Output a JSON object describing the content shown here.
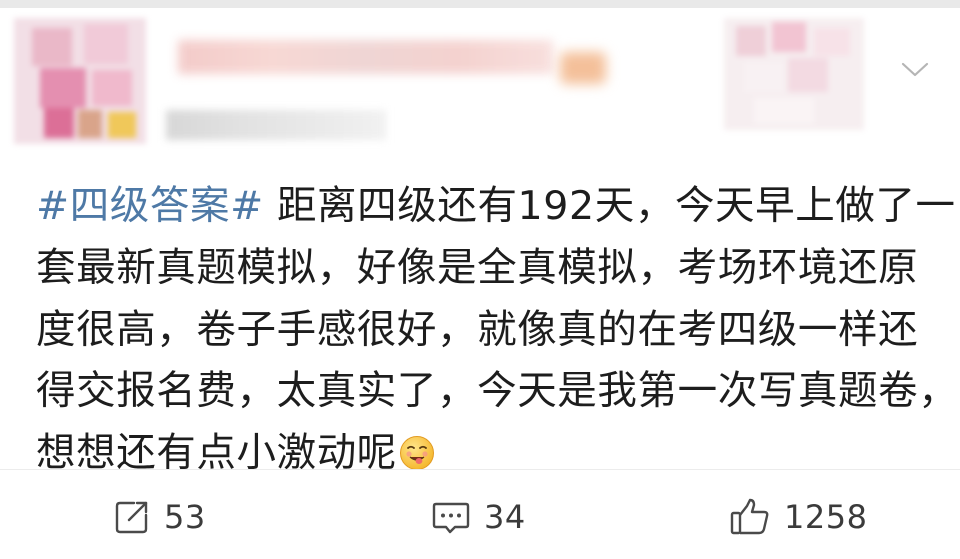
{
  "post": {
    "hashtag": "#四级答案#",
    "lines": [
      "距离四级还有192天，今天早上做了一",
      "套最新真题模拟，好像是全真模拟，考场环境还原",
      "度很高，卷子手感很好，就像真的在考四级一样还",
      "得交报名费，太真实了，今天是我第一次写真题卷，",
      "想想还有点小激动呢"
    ],
    "emoji": "drooling-face-emoji"
  },
  "header": {
    "avatar": "blurred-avatar",
    "menu_icon": "chevron-down-icon"
  },
  "actions": {
    "share": {
      "icon": "share-icon",
      "count": "53"
    },
    "comment": {
      "icon": "comment-icon",
      "count": "34"
    },
    "like": {
      "icon": "thumbs-up-icon",
      "count": "1258"
    }
  },
  "colors": {
    "hashtag": "#4e79a6",
    "text": "#1d1d1d",
    "icon": "#4a4a4a"
  }
}
